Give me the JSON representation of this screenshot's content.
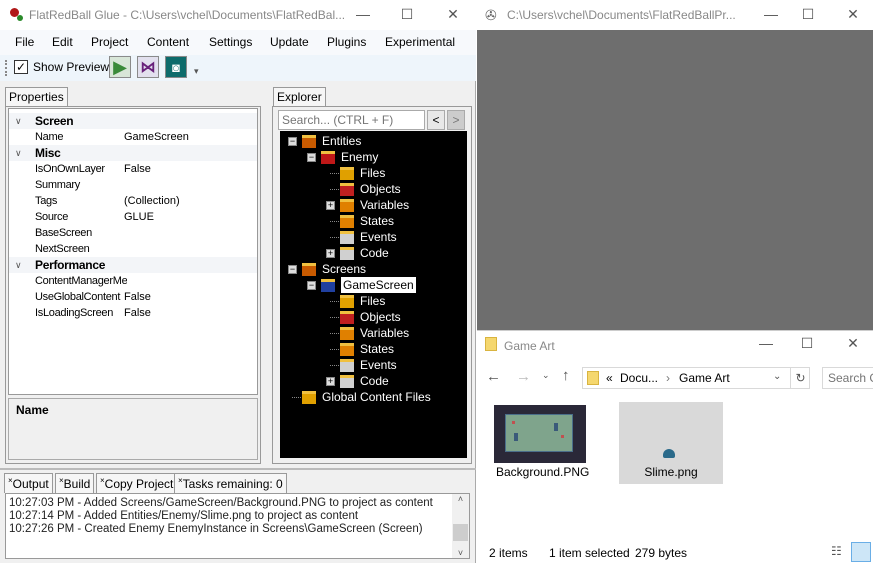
{
  "glue": {
    "title": "FlatRedBall Glue - C:\\Users\\vchel\\Documents\\FlatRedBal...",
    "menu": [
      "File",
      "Edit",
      "Project",
      "Content",
      "Settings",
      "Update",
      "Plugins",
      "Experimental"
    ],
    "toolbar": {
      "show_preview_label": "Show Preview",
      "show_preview_checked": true,
      "icons": [
        "play-icon",
        "visual-studio-icon",
        "camera-icon"
      ]
    },
    "properties": {
      "tab": "Properties",
      "rows": [
        {
          "cat": "Screen"
        },
        {
          "k": "Name",
          "v": "GameScreen"
        },
        {
          "cat": "Misc"
        },
        {
          "k": "IsOnOwnLayer",
          "v": "False"
        },
        {
          "k": "Summary",
          "v": ""
        },
        {
          "k": "Tags",
          "v": "(Collection)"
        },
        {
          "k": "Source",
          "v": "GLUE"
        },
        {
          "k": "BaseScreen",
          "v": ""
        },
        {
          "k": "NextScreen",
          "v": ""
        },
        {
          "cat": "Performance"
        },
        {
          "k": "ContentManagerMethod",
          "v": ""
        },
        {
          "k": "UseGlobalContent",
          "v": "False"
        },
        {
          "k": "IsLoadingScreen",
          "v": "False"
        }
      ],
      "help_title": "Name"
    },
    "explorer": {
      "tab": "Explorer",
      "search_placeholder": "Search... (CTRL + F)",
      "back": "<",
      "forward": ">",
      "nodes": [
        {
          "label": "Entities",
          "level": 0,
          "exp": "-"
        },
        {
          "label": "Enemy",
          "level": 1,
          "exp": "-"
        },
        {
          "label": "Files",
          "level": 2
        },
        {
          "label": "Objects",
          "level": 2
        },
        {
          "label": "Variables",
          "level": 2,
          "exp": "+"
        },
        {
          "label": "States",
          "level": 2
        },
        {
          "label": "Events",
          "level": 2
        },
        {
          "label": "Code",
          "level": 2,
          "exp": "+"
        },
        {
          "label": "Screens",
          "level": 0,
          "exp": "-"
        },
        {
          "label": "GameScreen",
          "level": 1,
          "exp": "-",
          "selected": true
        },
        {
          "label": "Files",
          "level": 2
        },
        {
          "label": "Objects",
          "level": 2
        },
        {
          "label": "Variables",
          "level": 2
        },
        {
          "label": "States",
          "level": 2
        },
        {
          "label": "Events",
          "level": 2
        },
        {
          "label": "Code",
          "level": 2,
          "exp": "+"
        },
        {
          "label": "Global Content Files",
          "level": 0
        }
      ]
    },
    "output": {
      "tabs": [
        "Output",
        "Build",
        "Copy Project",
        "Tasks remaining: 0"
      ],
      "lines": [
        "10:27:03 PM - Added Screens/GameScreen/Background.PNG to project as content",
        "10:27:14 PM - Added Entities/Enemy/Slime.png to project as content",
        "10:27:26 PM - Created Enemy EnemyInstance in Screens\\GameScreen (Screen)"
      ]
    }
  },
  "preview": {
    "title": "C:\\Users\\vchel\\Documents\\FlatRedBallPr..."
  },
  "file_explorer": {
    "title": "Game Art",
    "breadcrumb": [
      "«",
      "Docu...",
      "›",
      "Game Art"
    ],
    "search_placeholder": "Search G",
    "files": [
      {
        "name": "Background.PNG"
      },
      {
        "name": "Slime.png",
        "selected": true
      }
    ],
    "status": {
      "count": "2 items",
      "selected": "1 item selected",
      "size": "279 bytes"
    }
  }
}
